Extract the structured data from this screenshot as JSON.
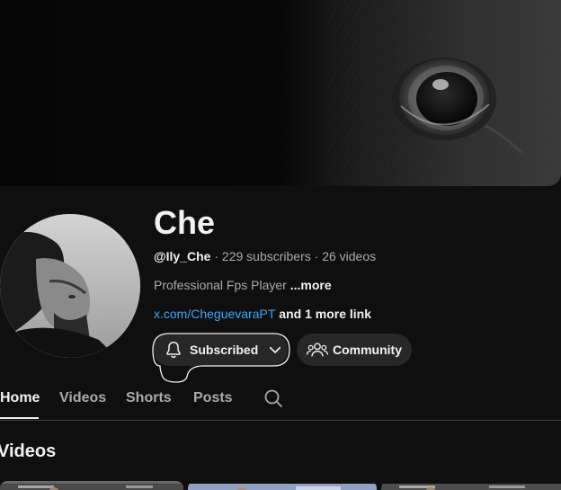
{
  "channel": {
    "name": "Che",
    "handle": "@Ily_Che",
    "subscribers": "229 subscribers",
    "videos": "26 videos",
    "separator": " · ",
    "description": "Professional Fps Player ",
    "more_label": "...more",
    "link_text": "x.com/CheguevaraPT",
    "more_links": " and 1 more link"
  },
  "actions": {
    "subscribed_label": "Subscribed",
    "community_label": "Community"
  },
  "tabs": [
    {
      "label": "Home",
      "active": true
    },
    {
      "label": "Videos",
      "active": false
    },
    {
      "label": "Shorts",
      "active": false
    },
    {
      "label": "Posts",
      "active": false
    }
  ],
  "section": {
    "title": "Videos"
  },
  "icons": {
    "bell": "bell-icon",
    "chevron": "chevron-down-icon",
    "community": "people-icon",
    "search": "search-icon"
  },
  "colors": {
    "background": "#0f0f0f",
    "text_primary": "#f1f1f1",
    "text_secondary": "#aaaaaa",
    "link": "#3ea6ff",
    "button_bg": "#272727"
  }
}
